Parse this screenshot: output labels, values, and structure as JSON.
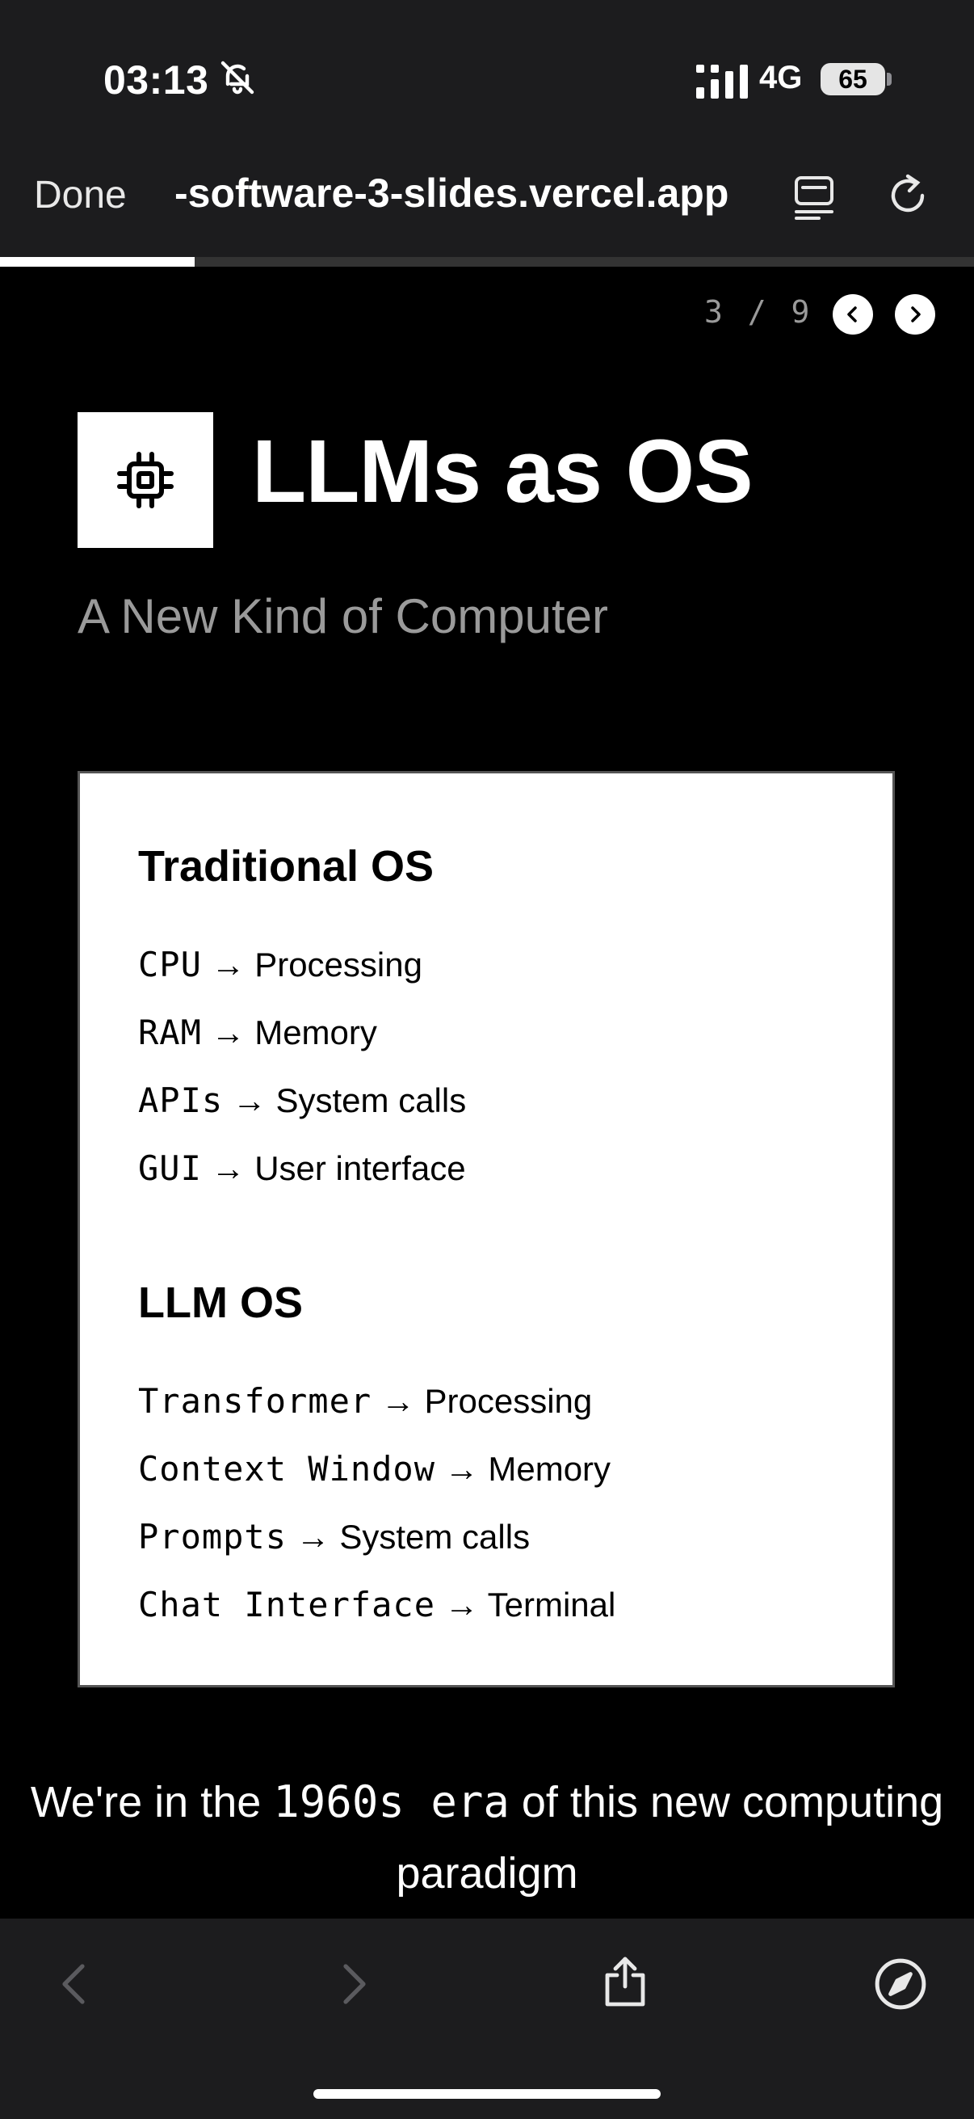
{
  "status_bar": {
    "time": "03:13",
    "network": "4G",
    "battery": "65"
  },
  "browser": {
    "done_label": "Done",
    "url": "-software-3-slides.vercel.app",
    "page_load_progress": 0.2
  },
  "slide": {
    "counter": "3 / 9",
    "title": "LLMs as OS",
    "subtitle": "A New Kind of Computer",
    "sections": [
      {
        "heading": "Traditional OS",
        "rows": [
          {
            "term": "CPU",
            "arrow": " → ",
            "meaning": "Processing"
          },
          {
            "term": "RAM",
            "arrow": " → ",
            "meaning": "Memory"
          },
          {
            "term": "APIs",
            "arrow": " → ",
            "meaning": "System calls"
          },
          {
            "term": "GUI",
            "arrow": " → ",
            "meaning": "User interface"
          }
        ]
      },
      {
        "heading": "LLM OS",
        "rows": [
          {
            "term": "Transformer",
            "arrow": " → ",
            "meaning": "Processing"
          },
          {
            "term": "Context Window",
            "arrow": " → ",
            "meaning": "Memory"
          },
          {
            "term": "Prompts",
            "arrow": " → ",
            "meaning": "System calls"
          },
          {
            "term": "Chat Interface",
            "arrow": " → ",
            "meaning": "Terminal"
          }
        ]
      }
    ],
    "footer": {
      "before": "We're in the ",
      "mono": "1960s era",
      "after": " of this new computing paradigm"
    }
  },
  "colors": {
    "background": "#000000",
    "chrome": "#1c1c1e",
    "muted_text": "#9a9a9a",
    "card": "#ffffff"
  },
  "icons": [
    "bell-slash-icon",
    "signal-icon",
    "battery-icon",
    "reader-icon",
    "reload-icon",
    "chevron-left-icon",
    "chevron-right-icon",
    "cpu-chip-icon",
    "back-icon",
    "forward-icon",
    "share-icon",
    "compass-icon"
  ]
}
